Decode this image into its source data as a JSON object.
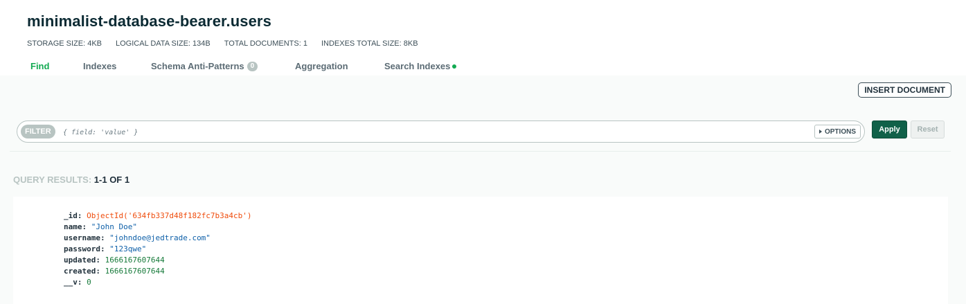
{
  "header": {
    "collection_name": "minimalist-database-bearer.users",
    "stats": {
      "storage_size": "STORAGE SIZE: 4KB",
      "logical_data_size": "LOGICAL DATA SIZE: 134B",
      "total_documents": "TOTAL DOCUMENTS: 1",
      "indexes_total_size": "INDEXES TOTAL SIZE: 8KB"
    },
    "tabs": [
      {
        "label": "Find",
        "active": true
      },
      {
        "label": "Indexes"
      },
      {
        "label": "Schema Anti-Patterns",
        "badge": "0"
      },
      {
        "label": "Aggregation"
      },
      {
        "label": "Search Indexes",
        "indicator": "green-dot-icon"
      }
    ]
  },
  "toolbar": {
    "insert_label": "INSERT DOCUMENT",
    "filter_label": "FILTER",
    "filter_placeholder": "{ field: 'value' }",
    "options_label": "OPTIONS",
    "apply_label": "Apply",
    "reset_label": "Reset"
  },
  "results": {
    "label": "QUERY RESULTS:",
    "count": "1-1 OF 1"
  },
  "document": {
    "fields": [
      {
        "key": "_id:",
        "value": "ObjectId('634fb337d48f182fc7b3a4cb')",
        "type": "oid"
      },
      {
        "key": "name:",
        "value": "\"John Doe\"",
        "type": "str"
      },
      {
        "key": "username:",
        "value": "\"johndoe@jedtrade.com\"",
        "type": "str"
      },
      {
        "key": "password:",
        "value": "\"123qwe\"",
        "type": "str"
      },
      {
        "key": "updated:",
        "value": "1666167607644",
        "type": "num"
      },
      {
        "key": "created:",
        "value": "1666167607644",
        "type": "num"
      },
      {
        "key": "__v:",
        "value": "0",
        "type": "num"
      }
    ]
  },
  "colors": {
    "accent_green": "#13aa52",
    "apply_button": "#116149",
    "objectid": "#ef4c0c",
    "string": "#0d5fa8",
    "number": "#167a3a"
  }
}
